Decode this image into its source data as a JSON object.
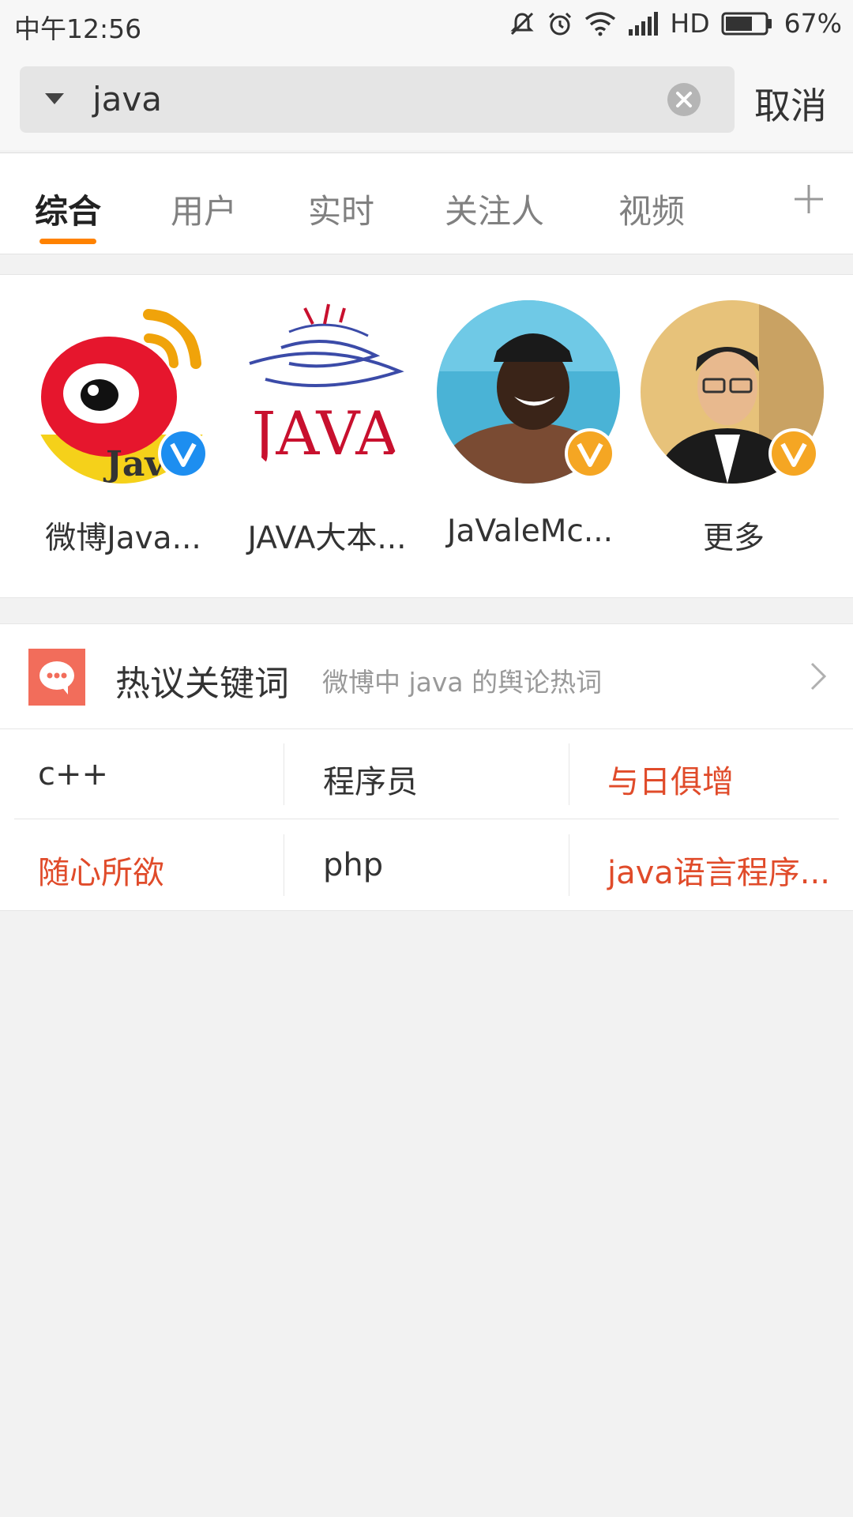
{
  "status_bar": {
    "time": "中午12:56",
    "network": "HD",
    "battery": "67%",
    "icons": [
      "mute-icon",
      "alarm-icon",
      "wifi-icon",
      "signal-icon",
      "battery-icon"
    ]
  },
  "search": {
    "value": "java",
    "cancel_label": "取消"
  },
  "tabs": [
    {
      "label": "综合",
      "active": true
    },
    {
      "label": "用户",
      "active": false
    },
    {
      "label": "实时",
      "active": false
    },
    {
      "label": "关注人",
      "active": false
    },
    {
      "label": "视频",
      "active": false
    }
  ],
  "users": [
    {
      "name": "微博Java...",
      "badge": "blue-verified"
    },
    {
      "name": "JAVA大本...",
      "badge": "none"
    },
    {
      "name": "JaValeMc...",
      "badge": "gold-verified"
    },
    {
      "name": "更多",
      "badge": "gold-verified"
    }
  ],
  "avatar_logo_text": {
    "weibo_java": "Java",
    "java_logo": "JAVA"
  },
  "hot_keywords": {
    "title": "热议关键词",
    "subtitle": "微博中 java 的舆论热词",
    "rows": [
      [
        {
          "text": "c++",
          "hot": false
        },
        {
          "text": "程序员",
          "hot": false
        },
        {
          "text": "与日俱增",
          "hot": true
        }
      ],
      [
        {
          "text": "随心所欲",
          "hot": true
        },
        {
          "text": "php",
          "hot": false
        },
        {
          "text": "java语言程序...",
          "hot": true
        }
      ]
    ]
  },
  "colors": {
    "accent_orange": "#ff8200",
    "hot_red": "#e04b2a",
    "verified_blue": "#1d8ef0",
    "verified_gold": "#f5a623",
    "hot_icon_bg": "#f26d5b"
  }
}
